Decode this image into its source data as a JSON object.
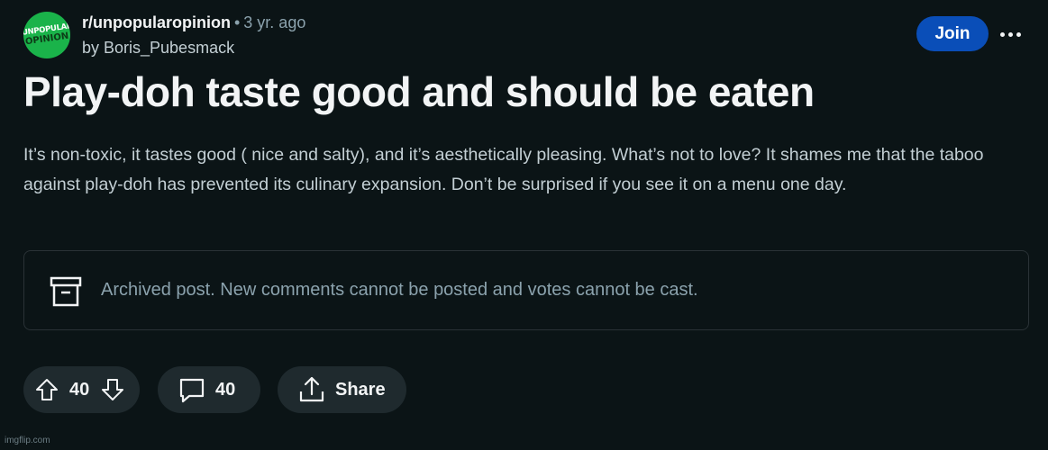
{
  "post": {
    "community": "r/unpopularopinion",
    "separator": "•",
    "age": "3 yr. ago",
    "author_line": "by Boris_Pubesmack",
    "avatar": {
      "line1": "UNPOPULAR",
      "line2": "OPINION",
      "color": "#1ab34a"
    },
    "join_label": "Join",
    "more_icon": "ellipsis-icon",
    "title": "Play-doh taste good and should be eaten",
    "body": "It’s non-toxic, it tastes good ( nice and salty), and it’s aesthetically pleasing. What’s not to love? It shames me that the taboo against play-doh has prevented its culinary expansion. Don’t be surprised if you see it on a menu one day.",
    "archived_notice": "Archived post. New comments cannot be posted and votes cannot be cast.",
    "actions": {
      "score": "40",
      "comment_count": "40",
      "share_label": "Share"
    }
  },
  "watermark": "imgflip.com",
  "colors": {
    "background": "#0b1416",
    "pill": "#1f2a2e",
    "join": "#0a4eb8",
    "muted_text": "#8ba2ad"
  }
}
